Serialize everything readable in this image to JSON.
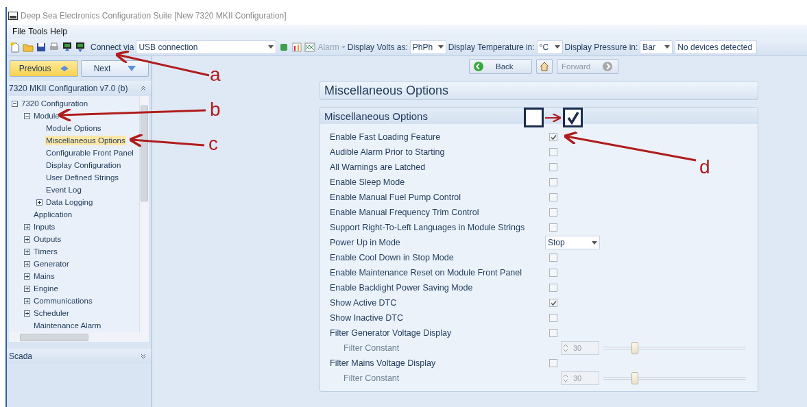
{
  "window": {
    "title": "Deep Sea Electronics Configuration Suite [New 7320 MKII Configuration]"
  },
  "menu": [
    "File",
    "Tools",
    "Help"
  ],
  "toolbar": {
    "connect_label": "Connect via",
    "connection": "USB connection",
    "alarm": "Alarm",
    "alarm_disabled": true,
    "volts_label": "Display Volts as:",
    "volts": "PhPh",
    "temp_label": "Display Temperature in:",
    "temp": "°C",
    "pressure_label": "Display Pressure in:",
    "pressure": "Bar",
    "status": "No devices detected"
  },
  "navigation": {
    "previous": "Previous",
    "next": "Next",
    "back": "Back",
    "forward": "Forward",
    "forward_disabled": true
  },
  "sidebar": {
    "header": "7320 MKII Configuration v7.0 (b)",
    "footer": "Scada",
    "tree": [
      {
        "label": "7320 Configuration",
        "expanded": true,
        "selected": false,
        "children": [
          {
            "label": "Module",
            "expanded": true,
            "selected": false,
            "children": [
              {
                "label": "Module Options",
                "selected": false
              },
              {
                "label": "Miscellaneous Options",
                "selected": true
              },
              {
                "label": "Configurable Front Panel",
                "selected": false
              },
              {
                "label": "Display Configuration",
                "selected": false
              },
              {
                "label": "User Defined Strings",
                "selected": false
              },
              {
                "label": "Event Log",
                "selected": false
              },
              {
                "label": "Data Logging",
                "expanded": false,
                "selected": false
              }
            ]
          },
          {
            "label": "Application",
            "selected": false
          },
          {
            "label": "Inputs",
            "expanded": false,
            "selected": false
          },
          {
            "label": "Outputs",
            "expanded": false,
            "selected": false
          },
          {
            "label": "Timers",
            "expanded": false,
            "selected": false
          },
          {
            "label": "Generator",
            "expanded": false,
            "selected": false
          },
          {
            "label": "Mains",
            "expanded": false,
            "selected": false
          },
          {
            "label": "Engine",
            "expanded": false,
            "selected": false
          },
          {
            "label": "Communications",
            "expanded": false,
            "selected": false
          },
          {
            "label": "Scheduler",
            "expanded": false,
            "selected": false
          },
          {
            "label": "Maintenance Alarm",
            "selected": false
          }
        ]
      }
    ]
  },
  "page": {
    "title": "Miscellaneous Options",
    "group_title": "Miscellaneous Options",
    "options": [
      {
        "kind": "checkbox",
        "label": "Enable Fast Loading Feature",
        "checked": true
      },
      {
        "kind": "checkbox",
        "label": "Audible Alarm Prior to Starting",
        "checked": false
      },
      {
        "kind": "checkbox",
        "label": "All Warnings are Latched",
        "checked": false
      },
      {
        "kind": "checkbox",
        "label": "Enable Sleep Mode",
        "checked": false
      },
      {
        "kind": "checkbox",
        "label": "Enable Manual Fuel Pump Control",
        "checked": false
      },
      {
        "kind": "checkbox",
        "label": "Enable Manual Frequency Trim Control",
        "checked": false
      },
      {
        "kind": "checkbox",
        "label": "Support Right-To-Left Languages in Module Strings",
        "checked": false
      },
      {
        "kind": "dropdown",
        "label": "Power Up in Mode",
        "value": "Stop"
      },
      {
        "kind": "checkbox",
        "label": "Enable Cool Down in Stop Mode",
        "checked": false
      },
      {
        "kind": "checkbox",
        "label": "Enable Maintenance Reset on Module Front Panel",
        "checked": false
      },
      {
        "kind": "checkbox",
        "label": "Enable Backlight Power Saving Mode",
        "checked": false
      },
      {
        "kind": "checkbox",
        "label": "Show Active DTC",
        "checked": true
      },
      {
        "kind": "checkbox",
        "label": "Show Inactive DTC",
        "checked": false
      },
      {
        "kind": "checkbox",
        "label": "Filter Generator Voltage Display",
        "checked": false
      },
      {
        "kind": "slider",
        "label": "Filter Constant",
        "value": "30",
        "level": 0.22,
        "disabled": true
      },
      {
        "kind": "checkbox",
        "label": "Filter Mains Voltage Display",
        "checked": false
      },
      {
        "kind": "slider",
        "label": "Filter Constant",
        "value": "30",
        "level": 0.22,
        "disabled": true
      }
    ]
  },
  "annotations": {
    "labels": [
      "a",
      "b",
      "c",
      "d"
    ],
    "legend": {
      "before_checked": false,
      "after_checked": true
    }
  }
}
